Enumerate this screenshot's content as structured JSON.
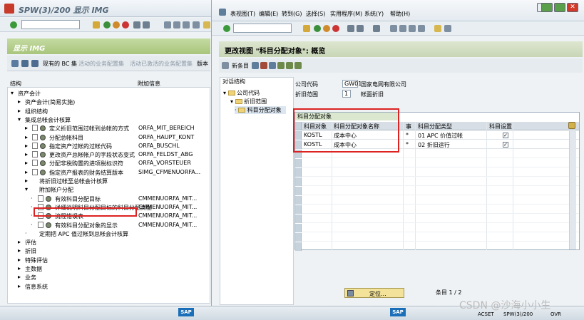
{
  "left": {
    "title": "SPW(3)/200 显示 IMG",
    "section_title": "显示 IMG",
    "toolbar2": [
      "现有的 BC 集",
      "活动的业务配置集",
      "活动已激活的业务配置集",
      "版本"
    ],
    "col_struct": "结构",
    "col_info": "附加信息",
    "tree": [
      {
        "label": "资产会计",
        "info": "",
        "level": 0,
        "exp": "▾"
      },
      {
        "label": "资产会计(简易实施)",
        "info": "",
        "level": 1,
        "exp": "▸"
      },
      {
        "label": "组织结构",
        "info": "",
        "level": 1,
        "exp": "▸"
      },
      {
        "label": "集成总帐会计核算",
        "info": "",
        "level": 1,
        "exp": "▾"
      },
      {
        "label": "定义折旧范围过帐到总帐的方式",
        "info": "ORFA_MIT_BEREICH",
        "level": 2,
        "exp": "▸"
      },
      {
        "label": "分配总帐科目",
        "info": "ORFA_HAUPT_KONT",
        "level": 2,
        "exp": "▸"
      },
      {
        "label": "指定资产过帐的过帐代码",
        "info": "ORFA_BUSCHL",
        "level": 2,
        "exp": "▸"
      },
      {
        "label": "更改资产总帐帐户的字段状态变式",
        "info": "ORFA_FELDST_ABG",
        "level": 2,
        "exp": "▸"
      },
      {
        "label": "分配非税购置的进项税标识符",
        "info": "ORFA_VORSTEUER",
        "level": 2,
        "exp": "▸"
      },
      {
        "label": "指定资产报表的财务结算版本",
        "info": "SIMG_CFMENUORFA...",
        "level": 2,
        "exp": "▸"
      },
      {
        "label": "将折旧过帐至总帐会计核算",
        "info": "",
        "level": 2,
        "exp": "▸"
      },
      {
        "label": "附加帐户分配",
        "info": "",
        "level": 2,
        "exp": "▾"
      },
      {
        "label": "有效科目分配目标",
        "info": "CMMENUORFA_MIT...",
        "level": 3,
        "exp": "·"
      },
      {
        "label": "详细说明科目分配目标的科目分配类型",
        "info": "CMMENUORFA_MIT...",
        "level": 3,
        "exp": "·"
      },
      {
        "label": "流程错误表",
        "info": "CMMENUORFA_MIT...",
        "level": 3,
        "exp": "·"
      },
      {
        "label": "有效科目分配对象的显示",
        "info": "CMMENUORFA_MIT...",
        "level": 3,
        "exp": "·"
      },
      {
        "label": "定期把 APC 值过帐到总帐会计核算",
        "info": "",
        "level": 2,
        "exp": "·"
      },
      {
        "label": "评估",
        "info": "",
        "level": 1,
        "exp": "▸"
      },
      {
        "label": "折旧",
        "info": "",
        "level": 1,
        "exp": "▸"
      },
      {
        "label": "特殊评估",
        "info": "",
        "level": 1,
        "exp": "▸"
      },
      {
        "label": "主数据",
        "info": "",
        "level": 1,
        "exp": "▸"
      },
      {
        "label": "业务",
        "info": "",
        "level": 1,
        "exp": "▸"
      },
      {
        "label": "信息系统",
        "info": "",
        "level": 1,
        "exp": "▸"
      }
    ]
  },
  "right": {
    "menu": [
      "表视图(T)",
      "编辑(E)",
      "转到(G)",
      "选择(S)",
      "实用程序(M)",
      "系统(Y)",
      "帮助(H)"
    ],
    "title": "更改视图 \"科目分配对象\": 概览",
    "new_entry": "新条目",
    "nav_title": "对话结构",
    "nav": [
      "公司代码",
      "折旧范围",
      "科目分配对象"
    ],
    "company_label": "公司代码",
    "company_code": "GW01",
    "company_name": "国家电网有限公司",
    "dep_label": "折旧范围",
    "dep_code": "1",
    "dep_name": "帐面折旧",
    "grid_title": "科目分配对象",
    "headers": [
      "科目对象",
      "科目分配对象名称",
      "事",
      "科目分配类型",
      "科目设置"
    ],
    "rows": [
      {
        "obj": "KOSTL",
        "name": "成本中心",
        "flag": "*",
        "type": "01 APC 价值过帐",
        "check": "✓"
      },
      {
        "obj": "KOSTL",
        "name": "成本中心",
        "flag": "*",
        "type": "02 折旧运行",
        "check": "✓"
      }
    ],
    "position_btn": "定位...",
    "entry_label": "条目 1 / 2"
  },
  "status": {
    "sap": "SAP",
    "acset": "ACSET",
    "sys": "SPW(3)/200",
    "ovr": "OVR"
  },
  "watermark": "CSDN @沙海小小生"
}
